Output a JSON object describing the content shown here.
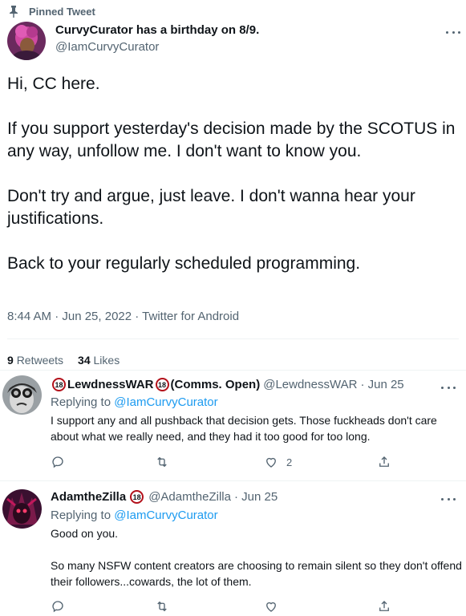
{
  "pinned": {
    "label": "Pinned Tweet"
  },
  "tweet": {
    "display_name": "CurvyCurator has a birthday on 8/9.",
    "handle": "@IamCurvyCurator",
    "paragraphs": [
      "Hi, CC here.",
      "If you support yesterday's decision made by the SCOTUS in any way, unfollow me. I don't want to know you.",
      "Don't try and argue, just leave. I don't wanna hear your justifications.",
      "Back to your regularly scheduled programming."
    ],
    "meta": "8:44 AM · Jun 25, 2022 · Twitter for Android",
    "retweets_count": "9",
    "retweets_label": "Retweets",
    "likes_count": "34",
    "likes_label": "Likes"
  },
  "replies": [
    {
      "name_prefix_badge": "18",
      "display_name": "LewdnessWAR",
      "name_badge": "18",
      "name_suffix": "(Comms. Open)",
      "handle": "@LewdnessWAR",
      "date": "· Jun 25",
      "replying_label": "Replying to",
      "replying_to": "@IamCurvyCurator",
      "body": [
        "I support any and all pushback that decision gets. Those fuckheads don't care about what we really need, and they had it too good for too long."
      ],
      "like_count": "2"
    },
    {
      "display_name": "AdamtheZilla",
      "name_badge": "18",
      "handle": "@AdamtheZilla",
      "date": "· Jun 25",
      "replying_label": "Replying to",
      "replying_to": "@IamCurvyCurator",
      "body": [
        "Good on you.",
        "So many NSFW content creators are choosing to remain silent so they don't offend their followers...cowards, the lot of them."
      ],
      "like_count": ""
    }
  ],
  "colors": {
    "accent": "#1d9bf0",
    "muted": "#536471",
    "text": "#0f1419",
    "divider": "#eff3f4",
    "badge": "#b3111b"
  },
  "icons": [
    "pin-icon",
    "more-icon",
    "reply-icon",
    "retweet-icon",
    "like-icon",
    "share-icon",
    "badge-18-icon"
  ]
}
